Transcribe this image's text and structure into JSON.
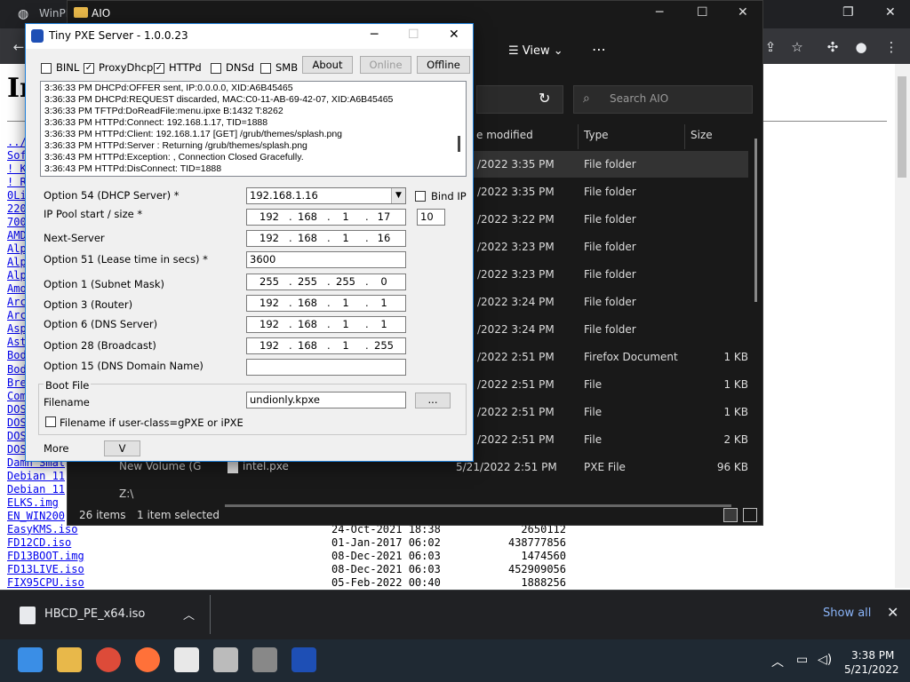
{
  "browser": {
    "tab_title": "WinPE",
    "page_heading": "In",
    "listing": [
      {
        "name": "../",
        "date": "",
        "size": ""
      },
      {
        "name": "Sof",
        "date": "",
        "size": ""
      },
      {
        "name": "! K",
        "date": "",
        "size": ""
      },
      {
        "name": "! R",
        "date": "",
        "size": ""
      },
      {
        "name": "0Li",
        "date": "",
        "size": ""
      },
      {
        "name": "220",
        "date": "",
        "size": ""
      },
      {
        "name": "700",
        "date": "",
        "size": ""
      },
      {
        "name": "AMD",
        "date": "",
        "size": ""
      },
      {
        "name": "Alp",
        "date": "",
        "size": ""
      },
      {
        "name": "Alp",
        "date": "",
        "size": ""
      },
      {
        "name": "Alp",
        "date": "",
        "size": ""
      },
      {
        "name": "Amo",
        "date": "",
        "size": ""
      },
      {
        "name": "Arc",
        "date": "",
        "size": ""
      },
      {
        "name": "Arc",
        "date": "",
        "size": ""
      },
      {
        "name": "Asp",
        "date": "",
        "size": ""
      },
      {
        "name": "Ast",
        "date": "",
        "size": ""
      },
      {
        "name": "Bod",
        "date": "",
        "size": ""
      },
      {
        "name": "Bod",
        "date": "",
        "size": ""
      },
      {
        "name": "Bre",
        "date": "",
        "size": ""
      },
      {
        "name": "Com",
        "date": "",
        "size": ""
      },
      {
        "name": "DOS",
        "date": "",
        "size": ""
      },
      {
        "name": "DOS",
        "date": "",
        "size": ""
      },
      {
        "name": "DOS",
        "date": "",
        "size": ""
      },
      {
        "name": "DOS",
        "date": "",
        "size": ""
      },
      {
        "name": "Damn Smal",
        "date": "",
        "size": ""
      },
      {
        "name": "Debian 11",
        "date": "",
        "size": ""
      },
      {
        "name": "Debian 11",
        "date": "",
        "size": ""
      },
      {
        "name": "ELKS.img",
        "date": "",
        "size": ""
      },
      {
        "name": "EN_WIN200",
        "date": "",
        "size": ""
      },
      {
        "name": "EasyKMS.iso",
        "date": "24-Oct-2021 18:38",
        "size": "2650112"
      },
      {
        "name": "FD12CD.iso",
        "date": "01-Jan-2017 06:02",
        "size": "438777856"
      },
      {
        "name": "FD13BOOT.img",
        "date": "08-Dec-2021 06:03",
        "size": "1474560"
      },
      {
        "name": "FD13LIVE.iso",
        "date": "08-Dec-2021 06:03",
        "size": "452909056"
      },
      {
        "name": "FIX95CPU.iso",
        "date": "05-Feb-2022 00:40",
        "size": "1888256"
      }
    ],
    "download": {
      "filename": "HBCD_PE_x64.iso",
      "show_all": "Show all"
    }
  },
  "explorer": {
    "title": "AIO",
    "view_label": "View",
    "search_placeholder": "Search AIO",
    "columns": {
      "date": "e modified",
      "type": "Type",
      "size": "Size"
    },
    "rows": [
      {
        "date": "/2022 3:35 PM",
        "type": "File folder",
        "size": ""
      },
      {
        "date": "/2022 3:35 PM",
        "type": "File folder",
        "size": ""
      },
      {
        "date": "/2022 3:22 PM",
        "type": "File folder",
        "size": ""
      },
      {
        "date": "/2022 3:23 PM",
        "type": "File folder",
        "size": ""
      },
      {
        "date": "/2022 3:23 PM",
        "type": "File folder",
        "size": ""
      },
      {
        "date": "/2022 3:24 PM",
        "type": "File folder",
        "size": ""
      },
      {
        "date": "/2022 3:24 PM",
        "type": "File folder",
        "size": ""
      },
      {
        "date": "/2022 2:51 PM",
        "type": "Firefox Document",
        "size": "1 KB"
      },
      {
        "date": "/2022 2:51 PM",
        "type": "File",
        "size": "1 KB"
      },
      {
        "date": "/2022 2:51 PM",
        "type": "File",
        "size": "1 KB"
      },
      {
        "date": "/2022 2:51 PM",
        "type": "File",
        "size": "2 KB"
      },
      {
        "date": "5/21/2022 2:51 PM",
        "type": "PXE File",
        "size": "96 KB"
      }
    ],
    "intel_name": "intel.pxe",
    "nav_volume": "New Volume (G",
    "nav_z": "Z:\\",
    "status_items": "26 items",
    "status_selected": "1 item selected"
  },
  "pxe": {
    "title": "Tiny PXE Server - 1.0.0.23",
    "checks": {
      "binl": "BINL",
      "proxydhcp": "ProxyDhcp",
      "httpd": "HTTPd",
      "dnsd": "DNSd",
      "smb": "SMB"
    },
    "buttons": {
      "about": "About",
      "online": "Online",
      "offline": "Offline",
      "browse": "...",
      "more": "V"
    },
    "log": [
      "3:36:33 PM DHCPd:OFFER sent, IP:0.0.0.0, XID:A6B45465",
      "3:36:33 PM DHCPd:REQUEST discarded, MAC:C0-11-AB-69-42-07, XID:A6B45465",
      "3:36:33 PM TFTPd:DoReadFile:menu.ipxe B:1432 T:8262",
      "3:36:33 PM HTTPd:Connect: 192.168.1.17, TID=1888",
      "3:36:33 PM HTTPd:Client: 192.168.1.17 [GET] /grub/themes/splash.png",
      "3:36:33 PM HTTPd:Server : Returning /grub/themes/splash.png",
      "3:36:43 PM HTTPd:Exception: , Connection Closed Gracefully.",
      "3:36:43 PM HTTPd:DisConnect: TID=1888"
    ],
    "labels": {
      "opt54": "Option 54 (DHCP Server) *",
      "pool": "IP Pool start / size *",
      "next_server": "Next-Server",
      "opt51": "Option 51 (Lease time in secs) *",
      "opt1": "Option 1  (Subnet Mask)",
      "opt3": "Option 3  (Router)",
      "opt6": "Option 6  (DNS Server)",
      "opt28": "Option 28 (Broadcast)",
      "opt15": "Option 15 (DNS Domain Name)",
      "bind_ip": "Bind IP",
      "boot_file": "Boot File",
      "filename": "Filename",
      "filename_if": "Filename if user-class=gPXE or iPXE",
      "more": "More"
    },
    "values": {
      "opt54": "192.168.1.16",
      "pool": [
        "192",
        "168",
        "1",
        "17"
      ],
      "pool_size": "10",
      "next_server": [
        "192",
        "168",
        "1",
        "16"
      ],
      "opt51": "3600",
      "opt1": [
        "255",
        "255",
        "255",
        "0"
      ],
      "opt3": [
        "192",
        "168",
        "1",
        "1"
      ],
      "opt6": [
        "192",
        "168",
        "1",
        "1"
      ],
      "opt28": [
        "192",
        "168",
        "1",
        "255"
      ],
      "opt15": "",
      "filename": "undionly.kpxe"
    }
  },
  "taskbar": {
    "time": "3:38 PM",
    "date": "5/21/2022"
  }
}
